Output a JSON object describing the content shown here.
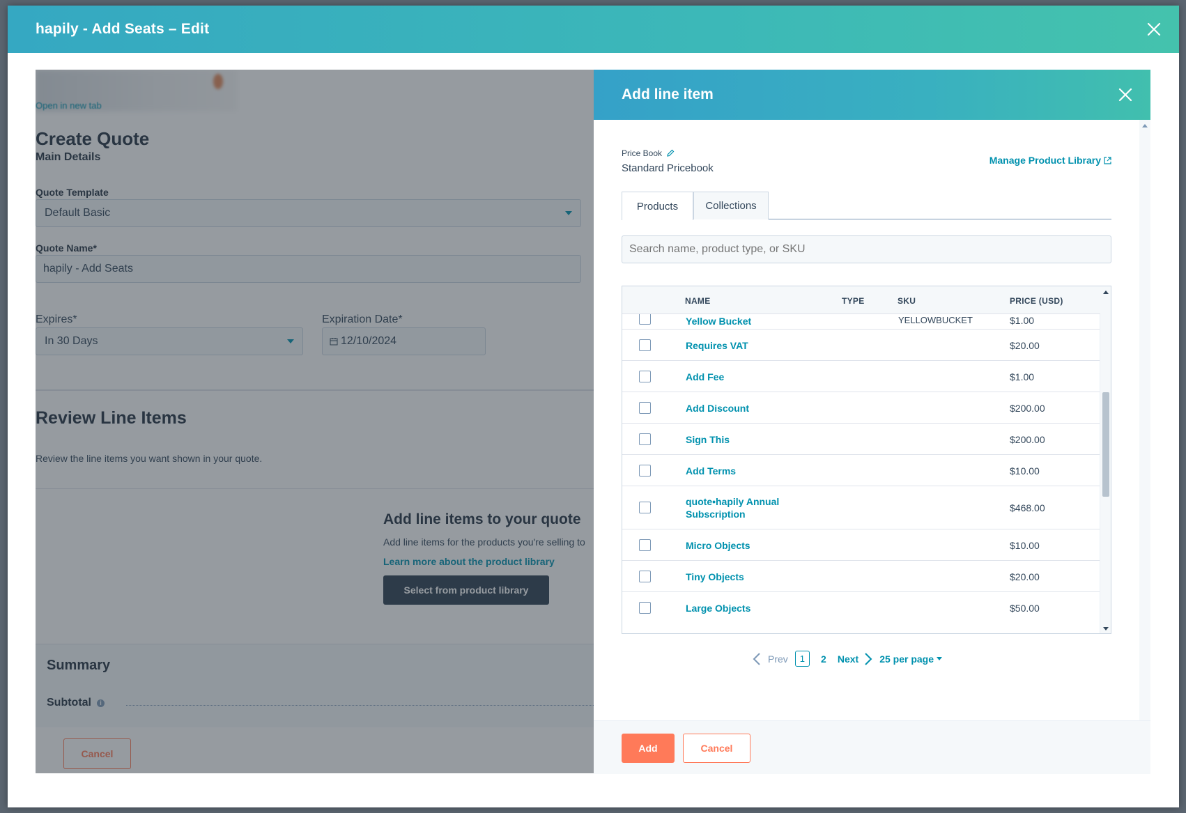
{
  "modal": {
    "title": "hapily - Add Seats – Edit"
  },
  "form": {
    "blurred_link": "Open in new tab",
    "heading": "Create Quote",
    "subheading": "Main Details",
    "template_label": "Quote Template",
    "template_value": "Default Basic",
    "name_label": "Quote Name*",
    "name_value": "hapily - Add Seats",
    "expires_label": "Expires*",
    "expires_value": "In 30 Days",
    "exp_date_label": "Expiration Date*",
    "exp_date_value": "12/10/2024",
    "review_heading": "Review Line Items",
    "review_desc": "Review the line items you want shown in your quote.",
    "empty_title": "Add line items to your quote",
    "empty_desc": "Add line items for the products you're selling to",
    "empty_link": "Learn more about the product library",
    "library_button": "Select from product library",
    "summary_title": "Summary",
    "subtotal_label": "Subtotal",
    "cancel_label": "Cancel"
  },
  "panel": {
    "title": "Add line item",
    "price_book_label": "Price Book",
    "price_book_value": "Standard Pricebook",
    "manage_link": "Manage Product Library",
    "tabs": [
      {
        "label": "Products"
      },
      {
        "label": "Collections"
      }
    ],
    "search_placeholder": "Search name, product type, or SKU",
    "columns": {
      "name": "NAME",
      "type": "TYPE",
      "sku": "SKU",
      "price": "PRICE (USD)"
    },
    "rows": [
      {
        "name": "Yellow Bucket",
        "sku": "YELLOWBUCKET",
        "price": "$1.00"
      },
      {
        "name": "Requires VAT",
        "sku": "",
        "price": "$20.00"
      },
      {
        "name": "Add Fee",
        "sku": "",
        "price": "$1.00"
      },
      {
        "name": "Add Discount",
        "sku": "",
        "price": "$200.00"
      },
      {
        "name": "Sign This",
        "sku": "",
        "price": "$200.00"
      },
      {
        "name": "Add Terms",
        "sku": "",
        "price": "$10.00"
      },
      {
        "name": "quote•hapily Annual Subscription",
        "sku": "",
        "price": "$468.00"
      },
      {
        "name": "Micro Objects",
        "sku": "",
        "price": "$10.00"
      },
      {
        "name": "Tiny Objects",
        "sku": "",
        "price": "$20.00"
      },
      {
        "name": "Large Objects",
        "sku": "",
        "price": "$50.00"
      }
    ],
    "pagination": {
      "prev": "Prev",
      "current": "1",
      "page2": "2",
      "next": "Next",
      "per_page": "25 per page"
    },
    "add_label": "Add",
    "cancel_label": "Cancel"
  },
  "colors": {
    "accent": "#0091ae",
    "primary_button": "#ff7a59",
    "header_start": "#35a8c2",
    "header_end": "#44c2ad"
  }
}
